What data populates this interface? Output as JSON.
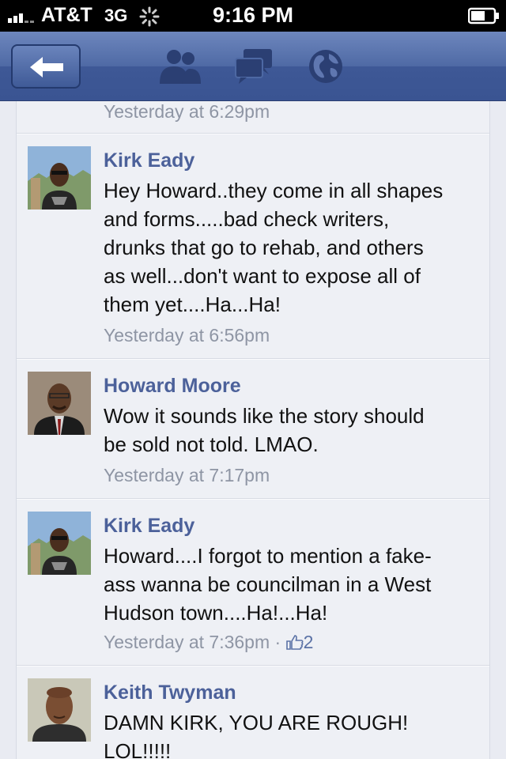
{
  "status_bar": {
    "carrier": "AT&T",
    "network": "3G",
    "time": "9:16 PM"
  },
  "nav": {
    "back_icon": "left-arrow-icon",
    "icons": [
      "friends-icon",
      "messages-icon",
      "globe-icon"
    ]
  },
  "feed": {
    "previous_timestamp": "Yesterday at 6:29pm",
    "comments": [
      {
        "author": "Kirk Eady",
        "lines": [
          "Hey Howard..they come in all shapes",
          "and forms.....bad check writers,",
          "drunks that go to rehab, and others",
          "as well...don't want to expose all of",
          "them yet....Ha...Ha!"
        ],
        "timestamp": "Yesterday at 6:56pm"
      },
      {
        "author": "Howard Moore",
        "lines": [
          "Wow it sounds like the story should",
          "be sold not told. LMAO."
        ],
        "timestamp": "Yesterday at 7:17pm"
      },
      {
        "author": "Kirk Eady",
        "lines": [
          "Howard....I forgot to mention a fake-",
          "ass wanna be councilman in a West",
          "Hudson town....Ha!...Ha!"
        ],
        "timestamp": "Yesterday at 7:36pm",
        "separator": "·",
        "likes": "2"
      },
      {
        "author": "Keith Twyman",
        "lines": [
          "DAMN KIRK, YOU ARE ROUGH!",
          "LOL!!!!!"
        ]
      }
    ]
  },
  "colors": {
    "nav_blue": "#3b5998",
    "author_blue": "#4c619a",
    "timestamp_gray": "#8e95a4"
  }
}
